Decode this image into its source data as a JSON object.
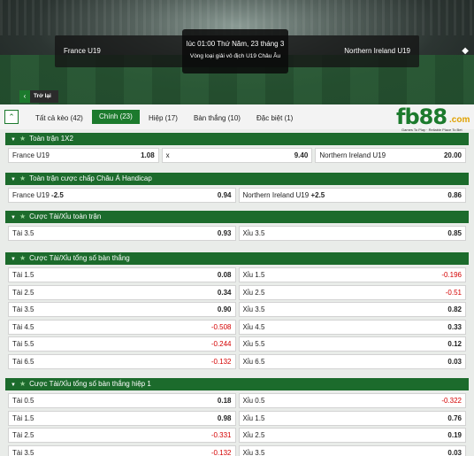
{
  "header": {
    "team_home": "France U19",
    "team_away": "Northern Ireland U19",
    "time": "lúc 01:00 Thứ Năm, 23 tháng 3",
    "league": "Vòng loại giải vô địch U19 Châu Âu",
    "back_label": "Trở lại"
  },
  "tabs": [
    {
      "label": "Tất cả kèo (42)"
    },
    {
      "label": "Chính (23)"
    },
    {
      "label": "Hiệp (17)"
    },
    {
      "label": "Bàn thắng (10)"
    },
    {
      "label": "Đặc biệt (1)"
    }
  ],
  "logo": {
    "brand": "fb88",
    "suffix": ".com",
    "tagline": "Games To Play · Reliable Place To Bet"
  },
  "sections": [
    {
      "title": "Toàn trận 1X2",
      "rows": [
        [
          {
            "label": "France U19",
            "value": "1.08"
          },
          {
            "label": "x",
            "value": "9.40"
          },
          {
            "label": "Northern Ireland U19",
            "value": "20.00"
          }
        ]
      ]
    },
    {
      "title": "Toàn trận cược chấp Châu Á Handicap",
      "rows": [
        [
          {
            "label": "France U19",
            "handicap": "-2.5",
            "value": "0.94"
          },
          {
            "label": "Northern Ireland U19",
            "handicap": "+2.5",
            "value": "0.86"
          }
        ]
      ]
    },
    {
      "title": "Cược Tài/Xỉu toàn trận",
      "rows": [
        [
          {
            "label": "Tài 3.5",
            "value": "0.93"
          },
          {
            "label": "Xỉu 3.5",
            "value": "0.85"
          }
        ]
      ]
    },
    {
      "title": "Cược Tài/Xỉu tổng số bàn thắng",
      "rows": [
        [
          {
            "label": "Tài 1.5",
            "value": "0.08"
          },
          {
            "label": "Xỉu 1.5",
            "value": "-0.196"
          }
        ],
        [
          {
            "label": "Tài 2.5",
            "value": "0.34"
          },
          {
            "label": "Xỉu 2.5",
            "value": "-0.51"
          }
        ],
        [
          {
            "label": "Tài 3.5",
            "value": "0.90"
          },
          {
            "label": "Xỉu 3.5",
            "value": "0.82"
          }
        ],
        [
          {
            "label": "Tài 4.5",
            "value": "-0.508"
          },
          {
            "label": "Xỉu 4.5",
            "value": "0.33"
          }
        ],
        [
          {
            "label": "Tài 5.5",
            "value": "-0.244"
          },
          {
            "label": "Xỉu 5.5",
            "value": "0.12"
          }
        ],
        [
          {
            "label": "Tài 6.5",
            "value": "-0.132"
          },
          {
            "label": "Xỉu 6.5",
            "value": "0.03"
          }
        ]
      ]
    },
    {
      "title": "Cược Tài/Xỉu tổng số bàn thắng hiệp 1",
      "rows": [
        [
          {
            "label": "Tài 0.5",
            "value": "0.18"
          },
          {
            "label": "Xỉu 0.5",
            "value": "-0.322"
          }
        ],
        [
          {
            "label": "Tài 1.5",
            "value": "0.98"
          },
          {
            "label": "Xỉu 1.5",
            "value": "0.76"
          }
        ],
        [
          {
            "label": "Tài 2.5",
            "value": "-0.331"
          },
          {
            "label": "Xỉu 2.5",
            "value": "0.19"
          }
        ],
        [
          {
            "label": "Tài 3.5",
            "value": "-0.132"
          },
          {
            "label": "Xỉu 3.5",
            "value": "0.03"
          }
        ]
      ]
    }
  ]
}
